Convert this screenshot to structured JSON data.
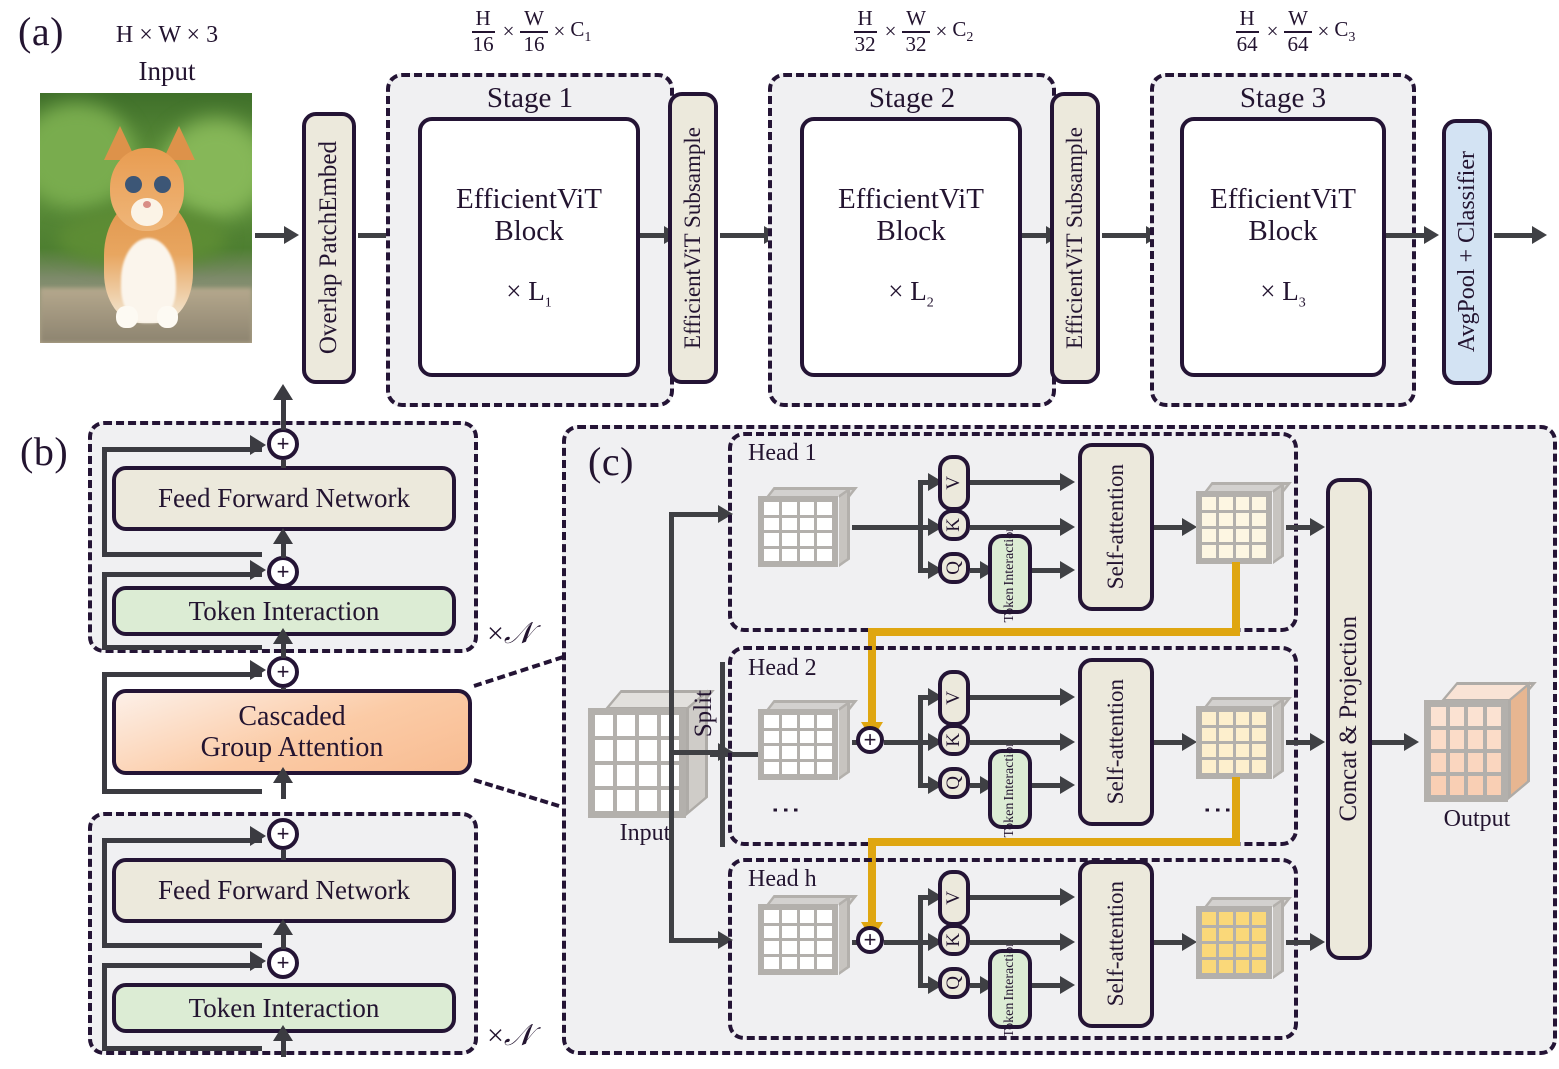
{
  "figure": {
    "panels": [
      {
        "id": "a",
        "label": "(a)"
      },
      {
        "id": "b",
        "label": "(b)"
      },
      {
        "id": "c",
        "label": "(c)"
      }
    ]
  },
  "panel_a": {
    "input": {
      "dims": {
        "h": "H",
        "sep1": "×",
        "w": "W",
        "sep2": "×",
        "c": "3"
      },
      "dims_text": "H × W × 3",
      "label": "Input",
      "image_alt": "kitten-photo"
    },
    "patch_embed": {
      "label": "Overlap PatchEmbed"
    },
    "stages": [
      {
        "name": "Stage 1",
        "dim": {
          "num1": "H",
          "den1": "16",
          "num2": "W",
          "den2": "16",
          "channels": "C",
          "channel_sub": "1",
          "times": "×"
        },
        "block_line1": "EfficientViT",
        "block_line2": "Block",
        "repeat": "× L",
        "repeat_sub": "1"
      },
      {
        "name": "Stage 2",
        "dim": {
          "num1": "H",
          "den1": "32",
          "num2": "W",
          "den2": "32",
          "channels": "C",
          "channel_sub": "2",
          "times": "×"
        },
        "block_line1": "EfficientViT",
        "block_line2": "Block",
        "repeat": "× L",
        "repeat_sub": "2"
      },
      {
        "name": "Stage 3",
        "dim": {
          "num1": "H",
          "den1": "64",
          "num2": "W",
          "den2": "64",
          "channels": "C",
          "channel_sub": "3",
          "times": "×"
        },
        "block_line1": "EfficientViT",
        "block_line2": "Block",
        "repeat": "× L",
        "repeat_sub": "3"
      }
    ],
    "subsamples": [
      {
        "label": "EfficientViT Subsample"
      },
      {
        "label": "EfficientViT Subsample"
      }
    ],
    "head": {
      "label": "AvgPool + Classifier"
    }
  },
  "panel_b": {
    "groups": [
      {
        "position": "top",
        "ffn": "Feed Forward Network",
        "token_interaction": "Token Interaction",
        "repeat": "×",
        "repeat_symbol": "𝒩"
      },
      {
        "position": "bottom",
        "ffn": "Feed Forward Network",
        "token_interaction": "Token Interaction",
        "repeat": "×",
        "repeat_symbol": "𝒩"
      }
    ],
    "attention": {
      "line1": "Cascaded",
      "line2": "Group Attention"
    },
    "plus_symbol": "+"
  },
  "panel_c": {
    "input": {
      "label": "Input"
    },
    "split": {
      "label": "Split"
    },
    "heads": [
      {
        "name": "Head 1",
        "v": "V",
        "k": "K",
        "q": "Q",
        "token_interaction_line1": "Token",
        "token_interaction_line2": "Interaction",
        "self_attention": "Self-attention",
        "output_tint": "#fdf6e2",
        "has_plus": false
      },
      {
        "name": "Head 2",
        "v": "V",
        "k": "K",
        "q": "Q",
        "token_interaction_line1": "Token",
        "token_interaction_line2": "Interaction",
        "self_attention": "Self-attention",
        "output_tint": "#fdefcd",
        "has_plus": true
      },
      {
        "name": "Head h",
        "v": "V",
        "k": "K",
        "q": "Q",
        "token_interaction_line1": "Token",
        "token_interaction_line2": "Interaction",
        "self_attention": "Self-attention",
        "output_tint": "#fad879",
        "has_plus": true
      }
    ],
    "concat": {
      "label": "Concat & Projection"
    },
    "output": {
      "label": "Output"
    },
    "plus_symbol": "+",
    "ellipsis": "⋮"
  },
  "colors": {
    "outline": "#241435",
    "cream": "#ece9dc",
    "green": "#dcecd4",
    "blue": "#d3e3f3",
    "orange": "#f8bc92",
    "gold": "#dfa611",
    "arrow": "#3f4044",
    "panel_bg": "#f0f0f2"
  }
}
